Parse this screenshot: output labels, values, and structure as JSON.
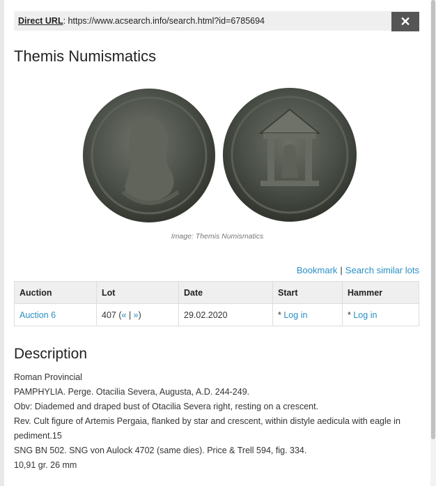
{
  "url_bar": {
    "label": "Direct URL",
    "url": "https://www.acsearch.info/search.html?id=6785694"
  },
  "close_glyph": "✕",
  "title": "Themis Numismatics",
  "image_caption": "Image: Themis Numismatics",
  "links": {
    "bookmark": "Bookmark",
    "separator": "|",
    "search_similar": "Search similar lots"
  },
  "table": {
    "headers": [
      "Auction",
      "Lot",
      "Date",
      "Start",
      "Hammer"
    ],
    "row": {
      "auction": "Auction 6",
      "lot": "407",
      "lot_prev": "«",
      "lot_sep": "|",
      "lot_next": "»",
      "date": "29.02.2020",
      "start_prefix": "*",
      "start_link": "Log in",
      "hammer_prefix": "*",
      "hammer_link": "Log in"
    }
  },
  "description": {
    "heading": "Description",
    "lines": [
      "Roman Provincial",
      "PAMPHYLIA. Perge. Otacilia Severa, Augusta, A.D. 244-249.",
      "Obv: Diademed and draped bust of Otacilia Severa right, resting on a crescent.",
      "Rev. Cult figure of Artemis Pergaia, flanked by star and crescent, within distyle aedicula with eagle in pediment.15",
      "SNG BN 502. SNG von Aulock 4702 (same dies). Price & Trell 594, fig. 334.",
      "10,91 gr. 26 mm"
    ]
  },
  "colors": {
    "link": "#2a8fc4",
    "close_bg": "#555555",
    "header_bg": "#efefef"
  }
}
